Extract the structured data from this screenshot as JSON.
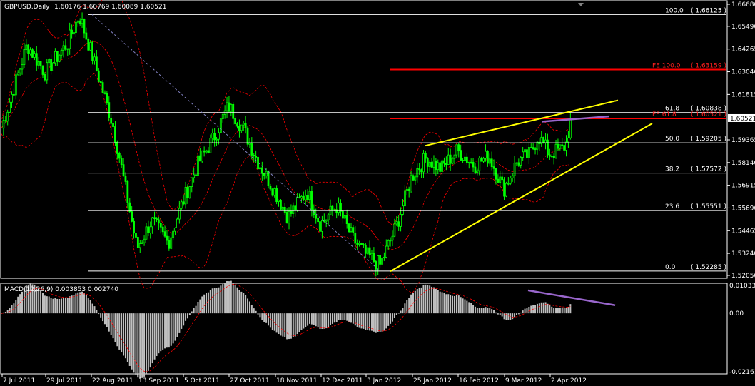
{
  "window": {
    "symbol": "GBPUSD,Daily",
    "ohlc": "1.60176 1.60769 1.60089 1.60521"
  },
  "price_axis": {
    "labels": [
      "1.66680",
      "1.65490",
      "1.64265",
      "1.63040",
      "1.61815",
      "1.59365",
      "1.58140",
      "1.56915",
      "1.55690",
      "1.54465",
      "1.53240",
      "1.52050"
    ],
    "current_price": "1.60521",
    "colors": {
      "background": "#000000",
      "axis": "#ffffff"
    }
  },
  "macd_axis": {
    "label": "MACD(12,26,9) 0.003853 0.002740",
    "labels": [
      "0.010335",
      "0.00",
      "-0.021610"
    ]
  },
  "time_axis": {
    "labels": [
      "7 Jul 2011",
      "29 Jul 2011",
      "22 Aug 2011",
      "13 Sep 2011",
      "5 Oct 2011",
      "27 Oct 2011",
      "18 Nov 2011",
      "12 Dec 2011",
      "3 Jan 2012",
      "25 Jan 2012",
      "16 Feb 2012",
      "9 Mar 2012",
      "2 Apr 2012"
    ]
  },
  "fib_levels": [
    {
      "pct": "100.0",
      "price_label": "( 1.66125 )",
      "value": 1.66125
    },
    {
      "pct": "61.8",
      "price_label": "( 1.60838 )",
      "value": 1.60838
    },
    {
      "pct": "50.0",
      "price_label": "( 1.59205 )",
      "value": 1.59205
    },
    {
      "pct": "38.2",
      "price_label": "( 1.57572 )",
      "value": 1.57572
    },
    {
      "pct": "23.6",
      "price_label": "( 1.55551 )",
      "value": 1.55551
    },
    {
      "pct": "0.0",
      "price_label": "( 1.52285 )",
      "value": 1.52285
    }
  ],
  "fe_levels": [
    {
      "label": "FE 100.0",
      "price_label": "( 1.63159 )",
      "value": 1.63159
    },
    {
      "label": "FE 61.8",
      "price_label": "( 1.60521 )",
      "value": 1.60521
    }
  ],
  "chart_data": {
    "type": "candlestick",
    "symbol": "GBPUSD",
    "timeframe": "Daily",
    "ylim": [
      1.5205,
      1.6668
    ],
    "macd_ylim": [
      -0.02161,
      0.010335
    ],
    "anchors": [
      {
        "date": "7 Jul 2011",
        "close": 1.6
      },
      {
        "date": "20 Jul 2011",
        "close": 1.645
      },
      {
        "date": "29 Jul 2011",
        "close": 1.63
      },
      {
        "date": "10 Aug 2011",
        "close": 1.646
      },
      {
        "date": "16 Aug 2011",
        "close": 1.661
      },
      {
        "date": "22 Aug 2011",
        "close": 1.642
      },
      {
        "date": "2 Sep 2011",
        "close": 1.6
      },
      {
        "date": "13 Sep 2011",
        "close": 1.535
      },
      {
        "date": "20 Sep 2011",
        "close": 1.55
      },
      {
        "date": "28 Sep 2011",
        "close": 1.538
      },
      {
        "date": "5 Oct 2011",
        "close": 1.56
      },
      {
        "date": "12 Oct 2011",
        "close": 1.58
      },
      {
        "date": "20 Oct 2011",
        "close": 1.595
      },
      {
        "date": "27 Oct 2011",
        "close": 1.612
      },
      {
        "date": "3 Nov 2011",
        "close": 1.6
      },
      {
        "date": "10 Nov 2011",
        "close": 1.582
      },
      {
        "date": "18 Nov 2011",
        "close": 1.566
      },
      {
        "date": "25 Nov 2011",
        "close": 1.552
      },
      {
        "date": "5 Dec 2011",
        "close": 1.566
      },
      {
        "date": "12 Dec 2011",
        "close": 1.548
      },
      {
        "date": "20 Dec 2011",
        "close": 1.558
      },
      {
        "date": "28 Dec 2011",
        "close": 1.54
      },
      {
        "date": "3 Jan 2012",
        "close": 1.532
      },
      {
        "date": "10 Jan 2012",
        "close": 1.526
      },
      {
        "date": "18 Jan 2012",
        "close": 1.548
      },
      {
        "date": "25 Jan 2012",
        "close": 1.574
      },
      {
        "date": "1 Feb 2012",
        "close": 1.584
      },
      {
        "date": "8 Feb 2012",
        "close": 1.578
      },
      {
        "date": "16 Feb 2012",
        "close": 1.588
      },
      {
        "date": "24 Feb 2012",
        "close": 1.58
      },
      {
        "date": "2 Mar 2012",
        "close": 1.585
      },
      {
        "date": "9 Mar 2012",
        "close": 1.567
      },
      {
        "date": "16 Mar 2012",
        "close": 1.582
      },
      {
        "date": "23 Mar 2012",
        "close": 1.586
      },
      {
        "date": "27 Mar 2012",
        "close": 1.596
      },
      {
        "date": "2 Apr 2012",
        "close": 1.586
      },
      {
        "date": "9 Apr 2012",
        "close": 1.589
      },
      {
        "date": "11 Apr 2012",
        "close": 1.592
      },
      {
        "date": "13 Apr 2012",
        "close": 1.60521
      }
    ],
    "colors": {
      "up_candle": "#00ff00",
      "down_candle": "#00ff00",
      "bollinger": "#ff0000",
      "fib": "#ffffff",
      "fe": "#ff0000",
      "channel": "#ffff00",
      "divergence": "#9966cc",
      "macd_hist": "#c0c0c0",
      "macd_signal": "#ff0000"
    }
  }
}
